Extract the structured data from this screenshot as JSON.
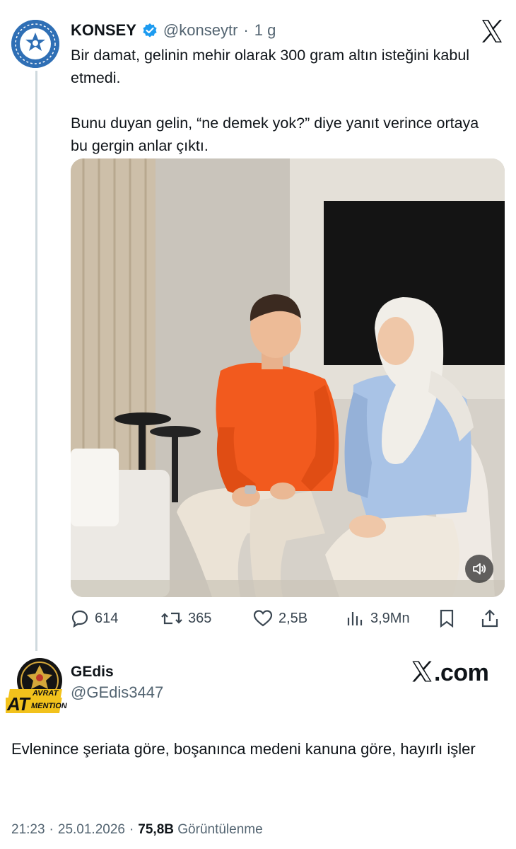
{
  "tweet": {
    "author_name": "KONSEY",
    "author_handle": "@konseytr",
    "separator": "·",
    "age": "1 g",
    "text_line1": "Bir damat, gelinin mehir olarak 300 gram altın isteğini kabul etmedi.",
    "text_line2": "Bunu duyan gelin, “ne demek yok?” diye yanıt verince ortaya bu gergin anlar çıktı.",
    "verified_icon": "verified-badge-icon",
    "close_icon": "x-logo-icon"
  },
  "actions": {
    "replies": "614",
    "reposts": "365",
    "likes": "2,5B",
    "views": "3,9Mn"
  },
  "reply": {
    "author_name": "GEdis",
    "author_handle": "@GEdis3447",
    "brand": "X.com",
    "brand_x": "𝕏",
    "brand_suffix": ".com",
    "text": "Evlenince şeriata göre, boşanınca medeni kanuna göre, hayırlı işler",
    "avatar_text_top": "AVRAT",
    "avatar_text_main": "AT",
    "avatar_text_bottom": "MENTION",
    "time": "21:23",
    "date": "25.01.2026",
    "separator": "·",
    "views_count": "75,8B",
    "views_label": "Görüntülenme"
  },
  "colors": {
    "text_primary": "#0f1419",
    "text_secondary": "#536471",
    "verified": "#1d9bf0",
    "thread_line": "#cfd9de",
    "shirt_orange": "#f25a1e",
    "shirt_blue": "#a9c3e6"
  }
}
